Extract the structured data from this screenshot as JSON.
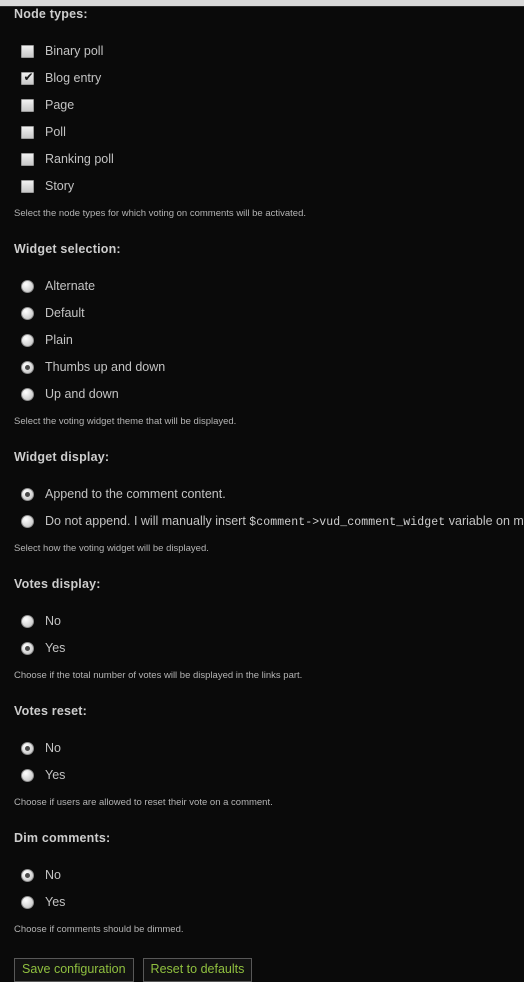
{
  "page": {
    "background_color": "#0a0a0a",
    "text_color": "#c3c3c3",
    "heading_color": "#cdcdcd",
    "button_text_color": "#8fbf3f",
    "top_bar_color": "#d9d9d9"
  },
  "sections": [
    {
      "title": "Node types:",
      "input_type": "checkbox",
      "options": [
        {
          "label": "Binary poll",
          "checked": false
        },
        {
          "label": "Blog entry",
          "checked": true
        },
        {
          "label": "Page",
          "checked": false
        },
        {
          "label": "Poll",
          "checked": false
        },
        {
          "label": "Ranking poll",
          "checked": false
        },
        {
          "label": "Story",
          "checked": false
        }
      ],
      "description": "Select the node types for which voting on comments will be activated."
    },
    {
      "title": "Widget selection:",
      "input_type": "radio",
      "options": [
        {
          "label": "Alternate",
          "checked": false
        },
        {
          "label": "Default",
          "checked": false
        },
        {
          "label": "Plain",
          "checked": false
        },
        {
          "label": "Thumbs up and down",
          "checked": true
        },
        {
          "label": "Up and down",
          "checked": false
        }
      ],
      "description": "Select the voting widget theme that will be displayed."
    },
    {
      "title": "Widget display:",
      "input_type": "radio",
      "options": [
        {
          "label": "Append to the comment content.",
          "checked": true
        },
        {
          "label_before": "Do not append. I will manually insert ",
          "code": "$comment->vud_comment_widget",
          "label_after": " variable on my theme.",
          "checked": false
        }
      ],
      "description": "Select how the voting widget will be displayed."
    },
    {
      "title": "Votes display:",
      "input_type": "radio",
      "options": [
        {
          "label": "No",
          "checked": false
        },
        {
          "label": "Yes",
          "checked": true
        }
      ],
      "description": "Choose if the total number of votes will be displayed in the links part."
    },
    {
      "title": "Votes reset:",
      "input_type": "radio",
      "options": [
        {
          "label": "No",
          "checked": true
        },
        {
          "label": "Yes",
          "checked": false
        }
      ],
      "description": "Choose if users are allowed to reset their vote on a comment."
    },
    {
      "title": "Dim comments:",
      "input_type": "radio",
      "options": [
        {
          "label": "No",
          "checked": true
        },
        {
          "label": "Yes",
          "checked": false
        }
      ],
      "description": "Choose if comments should be dimmed."
    }
  ],
  "actions": {
    "save_label": "Save configuration",
    "reset_label": "Reset to defaults"
  },
  "icons": {
    "checkmark": "✔"
  }
}
